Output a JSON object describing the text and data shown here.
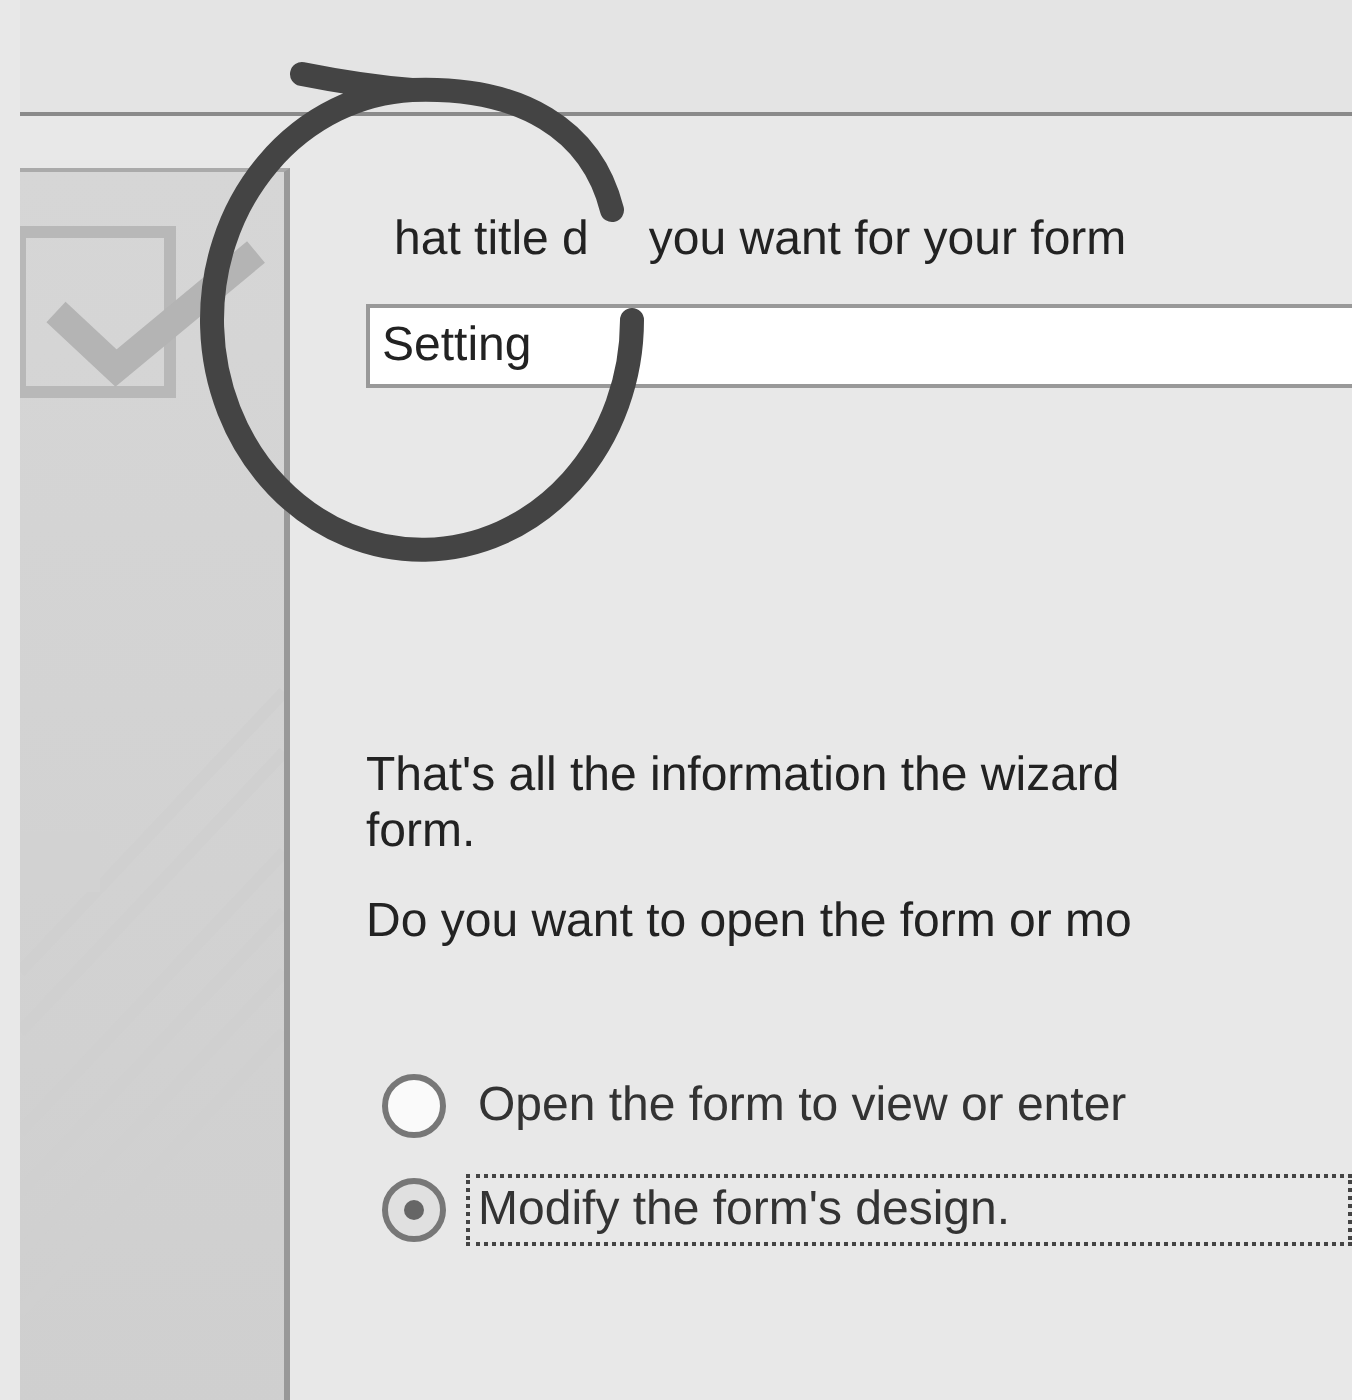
{
  "title_prompt": [
    "hat title d",
    "you want for your form"
  ],
  "title_field": {
    "value": "Setting"
  },
  "info_text": "That's all the information the wizard\nform.",
  "question": "Do you want to open the form or mo",
  "options": [
    {
      "label": "Open the form to view or enter",
      "selected": false
    },
    {
      "label": "Modify the form's design.",
      "selected": true
    }
  ]
}
